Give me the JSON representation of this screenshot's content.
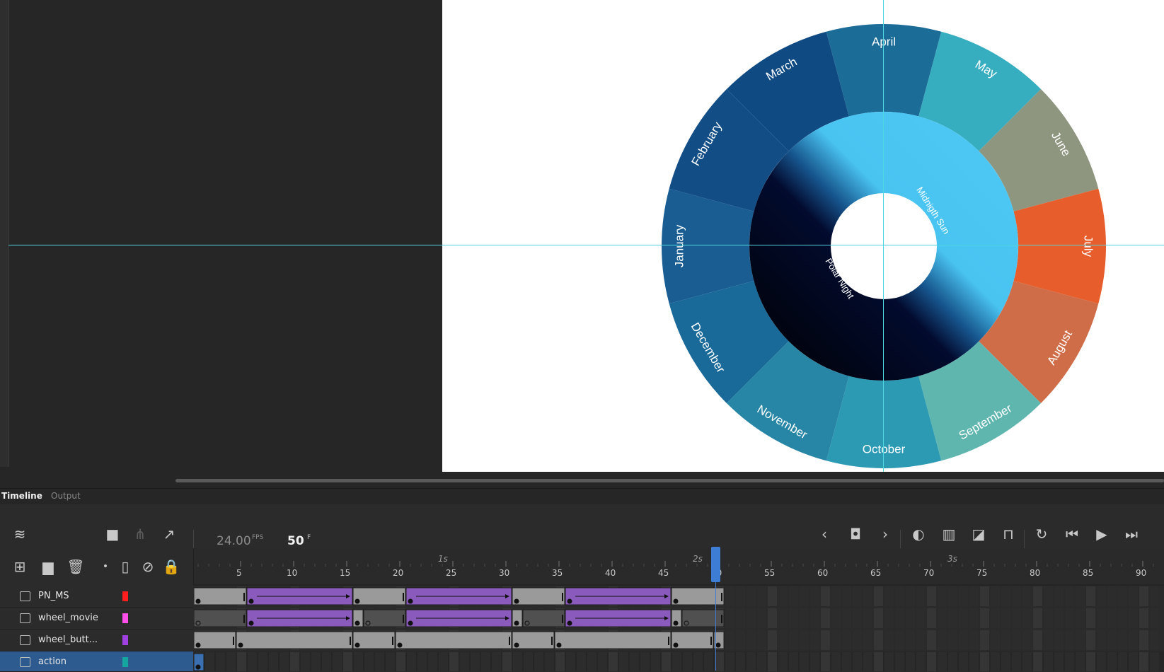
{
  "stage": {
    "canvas_color": "#ffffff",
    "guide_color": "#4fd6e0",
    "wheel": {
      "outer_segments": [
        {
          "label": "January",
          "color": "#195d92"
        },
        {
          "label": "February",
          "color": "#124d86"
        },
        {
          "label": "March",
          "color": "#0f4a82"
        },
        {
          "label": "April",
          "color": "#1c6c98"
        },
        {
          "label": "May",
          "color": "#36aebf"
        },
        {
          "label": "June",
          "color": "#8f9680"
        },
        {
          "label": "July",
          "color": "#e85d2c"
        },
        {
          "label": "August",
          "color": "#cf6d48"
        },
        {
          "label": "September",
          "color": "#5fb6ae"
        },
        {
          "label": "October",
          "color": "#2c9ab3"
        },
        {
          "label": "November",
          "color": "#2786a6"
        },
        {
          "label": "December",
          "color": "#196a98"
        }
      ],
      "inner_labels": {
        "light": "Midnigth Sun",
        "dark": "Polar Night"
      }
    }
  },
  "panel": {
    "tabs": [
      {
        "label": "Timeline",
        "active": true
      },
      {
        "label": "Output",
        "active": false
      }
    ],
    "fps_value": "24.00",
    "fps_unit": "FPS",
    "current_frame": "50",
    "frame_unit": "F",
    "layers": [
      {
        "name": "PN_MS",
        "color": "#ff1e1e",
        "selected": false
      },
      {
        "name": "wheel_movie",
        "color": "#ff4fe8",
        "selected": false
      },
      {
        "name": "wheel_butt...",
        "color": "#a040e0",
        "selected": false
      },
      {
        "name": "action",
        "color": "#16a6a0",
        "selected": true
      }
    ],
    "seconds_labels": [
      "1s",
      "2s",
      "3s"
    ],
    "frame_labels": [
      "5",
      "10",
      "15",
      "20",
      "25",
      "30",
      "35",
      "40",
      "45",
      "50",
      "55",
      "60",
      "65",
      "70",
      "75",
      "80",
      "85",
      "90"
    ],
    "tween_color": "#8a5bbd",
    "static_color": "#9a9a9a"
  }
}
